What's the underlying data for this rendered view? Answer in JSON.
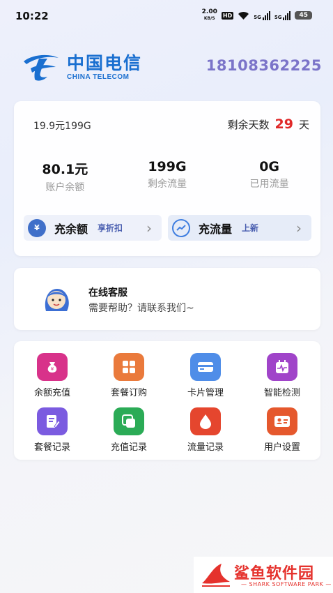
{
  "status": {
    "time": "10:22",
    "speed_value": "2.00",
    "speed_unit": "KB/S",
    "hd": "HD",
    "network1": "5G",
    "network2": "5G",
    "battery": "45"
  },
  "header": {
    "logo_cn": "中国电信",
    "logo_en": "CHINA TELECOM",
    "phone": "18108362225"
  },
  "account": {
    "plan": "19.9元199G",
    "days_label": "剩余天数",
    "days_value": "29",
    "days_unit": "天",
    "stats": [
      {
        "value": "80.1元",
        "label": "账户余额"
      },
      {
        "value": "199G",
        "label": "剩余流量"
      },
      {
        "value": "0G",
        "label": "已用流量"
      }
    ],
    "recharge_balance": {
      "label": "充余额",
      "tag": "享折扣",
      "icon_text": "¥"
    },
    "recharge_data": {
      "label": "充流量",
      "tag": "上新"
    }
  },
  "service": {
    "title": "在线客服",
    "subtitle": "需要帮助？请联系我们~"
  },
  "grid": [
    {
      "label": "余额充值",
      "icon": "money-bag-icon",
      "color": "#d8328a"
    },
    {
      "label": "套餐订购",
      "icon": "grid-apps-icon",
      "color": "#ea7a3c"
    },
    {
      "label": "卡片管理",
      "icon": "card-icon",
      "color": "#4f8de8"
    },
    {
      "label": "智能检测",
      "icon": "calendar-pulse-icon",
      "color": "#a044c9"
    },
    {
      "label": "套餐记录",
      "icon": "edit-document-icon",
      "color": "#7b5be0"
    },
    {
      "label": "充值记录",
      "icon": "copy-screen-icon",
      "color": "#2bab56"
    },
    {
      "label": "流量记录",
      "icon": "water-drop-icon",
      "color": "#e5462e"
    },
    {
      "label": "用户设置",
      "icon": "user-card-icon",
      "color": "#e5582d"
    }
  ],
  "watermark": {
    "text": "鲨鱼软件园",
    "sub": "— SHARK SOFTWARE PARK —"
  }
}
